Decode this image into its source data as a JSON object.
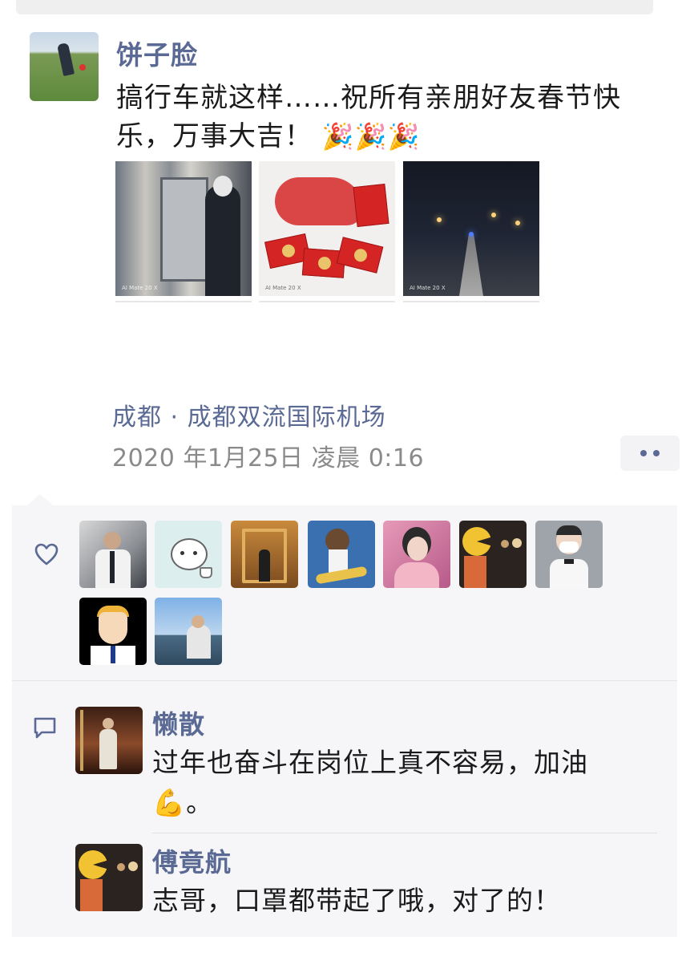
{
  "post": {
    "author": "饼子脸",
    "text": "搞行车就这样……祝所有亲朋好友春节快乐，万事大吉！",
    "emojis": "🎉🎉🎉",
    "photos": [
      {
        "caption": "AI Mate 20 X"
      },
      {
        "caption": "AI Mate 20 X"
      },
      {
        "caption": "AI Mate 20 X"
      }
    ],
    "location": "成都 · 成都双流国际机场",
    "timestamp": "2020 年1月25日 凌晨 0:16"
  },
  "likes": {
    "count": 9,
    "icon": "heart-outline-icon"
  },
  "comments": [
    {
      "author": "懒散",
      "text": "过年也奋斗在岗位上真不容易，加油",
      "emoji": "💪",
      "suffix": "。"
    },
    {
      "author": "傅竟航",
      "text": "志哥，口罩都带起了哦，对了的！"
    }
  ],
  "colors": {
    "name_link": "#5a6a94",
    "panel_bg": "#f6f6f8",
    "text": "#1a1a1a",
    "meta": "#8a8a8a"
  }
}
